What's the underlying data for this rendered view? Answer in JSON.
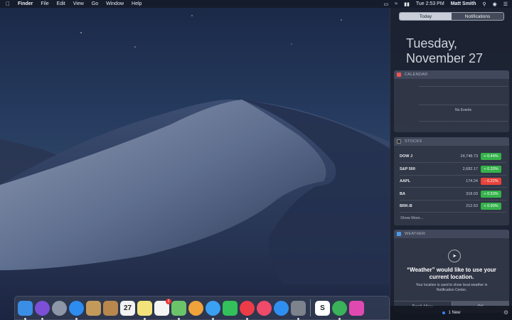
{
  "menubar": {
    "app_name": "Finder",
    "menus": [
      "File",
      "Edit",
      "View",
      "Go",
      "Window",
      "Help"
    ],
    "clock": "Tue 2:53 PM",
    "user": "Matt Smith"
  },
  "notification_center": {
    "tabs": [
      {
        "label": "Today",
        "active": true
      },
      {
        "label": "Notifications",
        "active": false
      }
    ],
    "date_line1": "Tuesday,",
    "date_line2": "November 27",
    "calendar": {
      "header": "CALENDAR",
      "empty_text": "No Events"
    },
    "stocks": {
      "header": "STOCKS",
      "rows": [
        {
          "symbol": "DOW J",
          "price": "24,748.73",
          "change": "+ 0.44%",
          "color": "#35b24a"
        },
        {
          "symbol": "S&P 500",
          "price": "2,682.17",
          "change": "+ 0.33%",
          "color": "#35b24a"
        },
        {
          "symbol": "AAPL",
          "price": "174.24",
          "change": "− 0.22%",
          "color": "#e8423b"
        },
        {
          "symbol": "BA",
          "price": "318.03",
          "change": "+ 0.53%",
          "color": "#35b24a"
        },
        {
          "symbol": "BRK-B",
          "price": "212.53",
          "change": "+ 0.90%",
          "color": "#35b24a"
        }
      ],
      "show_more": "Show More..."
    },
    "weather": {
      "header": "WEATHER",
      "title_line1": "“Weather” would like to use your",
      "title_line2": "current location.",
      "description": "Your location is used to show local weather in Notification Center.",
      "deny_label": "Don't Allow",
      "allow_label": "OK"
    },
    "footer": {
      "new_count": "1 New"
    }
  },
  "dock": {
    "apps": [
      {
        "name": "finder-icon",
        "color": "#3a8ee6"
      },
      {
        "name": "siri-icon",
        "color": "#7b4fd6"
      },
      {
        "name": "launchpad-icon",
        "color": "#8d96a6"
      },
      {
        "name": "safari-icon",
        "color": "#2d8cf0"
      },
      {
        "name": "preview-photo-icon",
        "color": "#c49a5a"
      },
      {
        "name": "contacts-icon",
        "color": "#b8874d"
      },
      {
        "name": "calendar-icon",
        "color": "#f2f2f2",
        "text": "27"
      },
      {
        "name": "notes-icon",
        "color": "#f3e37a"
      },
      {
        "name": "reminders-icon",
        "color": "#f4f4f4",
        "badge": "2"
      },
      {
        "name": "maps-icon",
        "color": "#6cc46a"
      },
      {
        "name": "photos-icon",
        "color": "#f0a23b"
      },
      {
        "name": "messages-icon",
        "color": "#3aa0f2"
      },
      {
        "name": "facetime-icon",
        "color": "#32c15a"
      },
      {
        "name": "news-icon",
        "color": "#ee3b48"
      },
      {
        "name": "music-icon",
        "color": "#f04a6a"
      },
      {
        "name": "app-store-icon",
        "color": "#2f8ff0"
      },
      {
        "name": "system-preferences-icon",
        "color": "#7d838d"
      },
      {
        "name": "slack-icon",
        "color": "#ffffff",
        "text": "S"
      },
      {
        "name": "evernote-icon",
        "color": "#3bb15a"
      },
      {
        "name": "colorful-app-icon",
        "color": "#e04ab0"
      }
    ]
  }
}
